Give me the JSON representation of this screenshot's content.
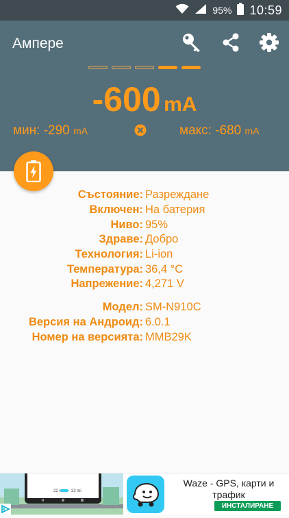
{
  "status_bar": {
    "battery_percent": "95%",
    "time": "10:59"
  },
  "header": {
    "title": "Ампере"
  },
  "current": {
    "value": "-600",
    "unit": "mA",
    "level_segments": 5,
    "level_active": 2
  },
  "min": {
    "label": "мин: -290",
    "unit": "mA"
  },
  "max": {
    "label": "макс: -680",
    "unit": "mA"
  },
  "info_rows": [
    {
      "label": "Състояние:",
      "value": "Разреждане"
    },
    {
      "label": "Включен:",
      "value": "На батерия"
    },
    {
      "label": "Ниво:",
      "value": "95%"
    },
    {
      "label": "Здраве:",
      "value": "Добро"
    },
    {
      "label": "Технология:",
      "value": "Li-ion"
    },
    {
      "label": "Температура:",
      "value": "36,4 °C"
    },
    {
      "label": "Напрежение:",
      "value": "4,271 V"
    }
  ],
  "device_rows": [
    {
      "label": "Модел:",
      "value": "SM-N910C"
    },
    {
      "label": "Версия на Андроид:",
      "value": "6.0.1"
    },
    {
      "label": "Номер на версията:",
      "value": "MMB29K"
    }
  ],
  "ad": {
    "title": "Waze - GPS, карти и трафик",
    "install_label": "ИНСТАЛИРАНЕ",
    "screenshot_texts": [
      "22 min",
      "32 mi"
    ]
  },
  "colors": {
    "header_bg": "#546e7a",
    "accent": "#ff9a1a",
    "status_bar_bg": "#3f4a51"
  }
}
